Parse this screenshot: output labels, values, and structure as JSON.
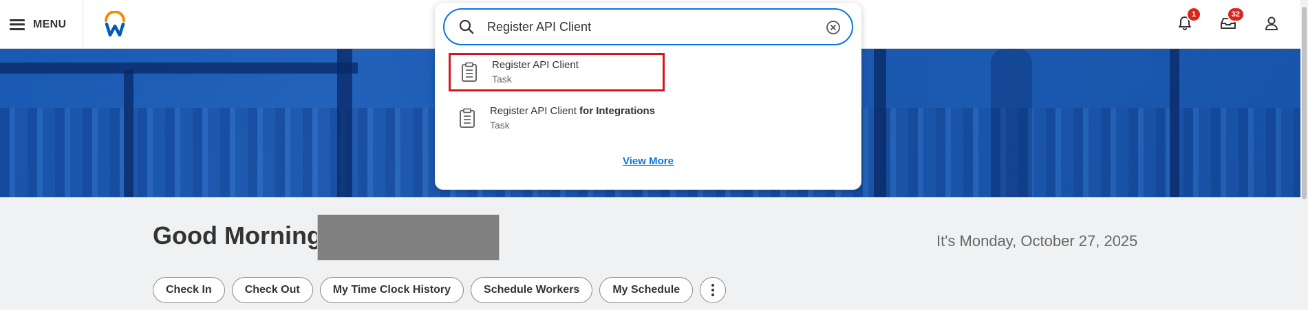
{
  "header": {
    "menu_label": "MENU",
    "logo_icon": "workday-logo",
    "notifications_count": "1",
    "inbox_count": "32",
    "profile_icon": "user-icon",
    "badge_color": "#d8261f"
  },
  "search": {
    "query": "Register API Client",
    "results": [
      {
        "title": "Register API Client",
        "title_suffix": "",
        "type": "Task",
        "icon": "clipboard-icon",
        "selected": true
      },
      {
        "title": "Register API Client",
        "title_suffix": " for Integrations",
        "type": "Task",
        "icon": "clipboard-icon",
        "selected": false
      }
    ],
    "view_more": "View More",
    "accent_color": "#0875e1",
    "highlight_color": "#d7141e"
  },
  "main": {
    "greeting": "Good Morning,",
    "date": "It's Monday, October 27, 2025",
    "quick_actions": [
      "Check In",
      "Check Out",
      "My Time Clock History",
      "Schedule Workers",
      "My Schedule"
    ],
    "more_icon": "more-vertical-icon"
  }
}
